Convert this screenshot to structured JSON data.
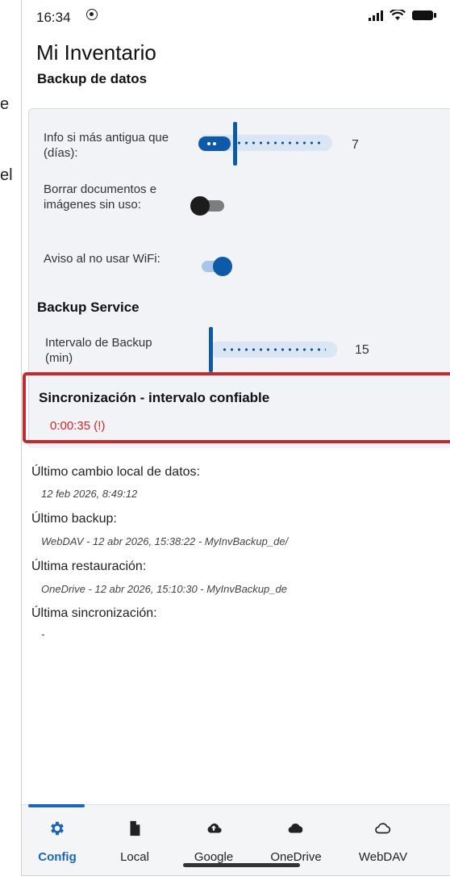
{
  "cut_text": {
    "line1": "e",
    "line2": "el"
  },
  "status_bar": {
    "time": "16:34"
  },
  "header": {
    "title": "Mi Inventario",
    "subtitle": "Backup de datos"
  },
  "settings": {
    "info_older_label": "Info si más antigua que (días):",
    "info_older_value": "7",
    "delete_unused_label": "Borrar documentos e imágenes sin uso:",
    "delete_unused_on": false,
    "wifi_warning_label": "Aviso al no usar WiFi:",
    "wifi_warning_on": true,
    "backup_service_title": "Backup Service",
    "backup_interval_label": "Intervalo de Backup (min)",
    "backup_interval_value": "15",
    "sync_title": "Sincronización - intervalo confiable",
    "sync_value": "0:00:35 (!)"
  },
  "info": {
    "last_local_change_label": "Último cambio local de datos:",
    "last_local_change_value": "12 feb 2026, 8:49:12",
    "last_backup_label": "Último backup:",
    "last_backup_value": "WebDAV - 12 abr 2026, 15:38:22 - MyInvBackup_de/",
    "last_restore_label": "Última restauración:",
    "last_restore_value": "OneDrive - 12 abr 2026, 15:10:30 - MyInvBackup_de",
    "last_sync_label": "Última sincronización:",
    "last_sync_value": "-"
  },
  "nav": {
    "items": [
      {
        "label": "Config",
        "icon": "gear-icon",
        "active": true
      },
      {
        "label": "Local",
        "icon": "file-icon",
        "active": false
      },
      {
        "label": "Google",
        "icon": "cloud-upload-icon",
        "active": false
      },
      {
        "label": "OneDrive",
        "icon": "onedrive-cloud-icon",
        "active": false
      },
      {
        "label": "WebDAV",
        "icon": "cloud-outline-icon",
        "active": false
      }
    ]
  },
  "colors": {
    "accent": "#1a67b8",
    "slider": "#0d5aa8",
    "warning": "#d62424",
    "highlight": "#c42a2a"
  }
}
